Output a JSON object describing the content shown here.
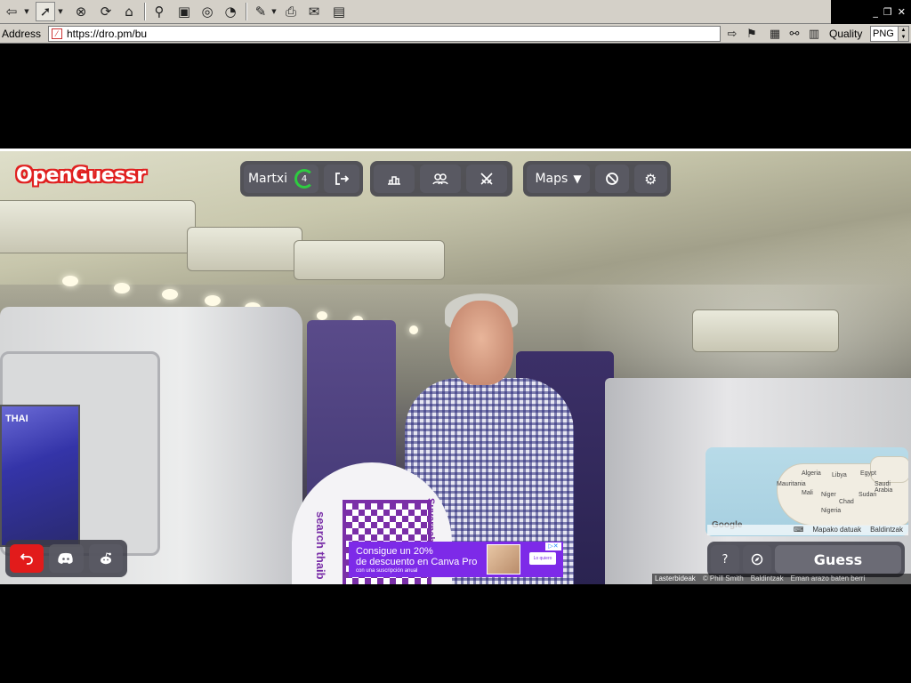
{
  "browser": {
    "address_label": "Address",
    "url": "https://dro.pm/bu",
    "quality_label": "Quality",
    "quality_value": "PNG"
  },
  "game": {
    "logo": "OpenGuessr",
    "player_name": "Martxi",
    "player_level": "4",
    "maps_label": "Maps",
    "guess_label": "Guess",
    "help_label": "?",
    "accent_red": "#e21b1b",
    "panel_color": "#3c3c46"
  },
  "minimap": {
    "labels": [
      "Algeria",
      "Libya",
      "Egypt",
      "Mali",
      "Niger",
      "Chad",
      "Sudan",
      "Mauritania",
      "Nigeria",
      "Saudi Arabia"
    ],
    "google": "Google",
    "map_data": "Mapako datuak",
    "terms": "Baldintzak"
  },
  "ad": {
    "line1": "Consigue un 20%",
    "line2": "de descuento en Canva Pro",
    "line3": "con una suscripción anual",
    "cta": "Lo quiero"
  },
  "scene": {
    "screen_text": "THAI",
    "sign_text_a": "search thaib",
    "sign_text_b": "Suvarnab"
  },
  "footer": {
    "shortcuts": "Lasterbideak",
    "copyright": "© Phill Smith",
    "terms": "Baldintzak",
    "report": "Eman arazo baten berri"
  }
}
